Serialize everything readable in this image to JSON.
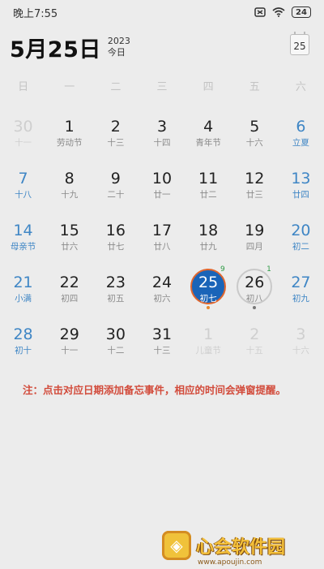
{
  "status": {
    "time": "晚上7:55",
    "battery": "24"
  },
  "header": {
    "date": "5月25日",
    "year": "2023",
    "today_label": "今日",
    "today_button": "25"
  },
  "weekdays": [
    "日",
    "一",
    "二",
    "三",
    "四",
    "五",
    "六"
  ],
  "days": [
    {
      "n": "30",
      "l": "十一",
      "dim": true
    },
    {
      "n": "1",
      "l": "劳动节"
    },
    {
      "n": "2",
      "l": "十三"
    },
    {
      "n": "3",
      "l": "十四"
    },
    {
      "n": "4",
      "l": "青年节"
    },
    {
      "n": "5",
      "l": "十六"
    },
    {
      "n": "6",
      "l": "立夏",
      "weekend": true
    },
    {
      "n": "7",
      "l": "十八",
      "weekend": true
    },
    {
      "n": "8",
      "l": "十九"
    },
    {
      "n": "9",
      "l": "二十"
    },
    {
      "n": "10",
      "l": "廿一"
    },
    {
      "n": "11",
      "l": "廿二"
    },
    {
      "n": "12",
      "l": "廿三"
    },
    {
      "n": "13",
      "l": "廿四",
      "weekend": true
    },
    {
      "n": "14",
      "l": "母亲节",
      "weekend": true
    },
    {
      "n": "15",
      "l": "廿六"
    },
    {
      "n": "16",
      "l": "廿七"
    },
    {
      "n": "17",
      "l": "廿八"
    },
    {
      "n": "18",
      "l": "廿九"
    },
    {
      "n": "19",
      "l": "四月"
    },
    {
      "n": "20",
      "l": "初二",
      "weekend": true
    },
    {
      "n": "21",
      "l": "小满",
      "weekend": true
    },
    {
      "n": "22",
      "l": "初四"
    },
    {
      "n": "23",
      "l": "初五"
    },
    {
      "n": "24",
      "l": "初六"
    },
    {
      "n": "25",
      "l": "初七",
      "today": true,
      "badge": "9"
    },
    {
      "n": "26",
      "l": "初八",
      "ring": true,
      "badge": "1"
    },
    {
      "n": "27",
      "l": "初九",
      "weekend": true
    },
    {
      "n": "28",
      "l": "初十",
      "weekend": true
    },
    {
      "n": "29",
      "l": "十一"
    },
    {
      "n": "30",
      "l": "十二"
    },
    {
      "n": "31",
      "l": "十三"
    },
    {
      "n": "1",
      "l": "儿童节",
      "dim": true
    },
    {
      "n": "2",
      "l": "十五",
      "dim": true
    },
    {
      "n": "3",
      "l": "十六",
      "dim": true
    }
  ],
  "note": "注：点击对应日期添加备忘事件，相应的时间会弹窗提醒。",
  "watermark": {
    "text": "心会软件园",
    "url": "www.apoujin.com"
  },
  "colors": {
    "accent": "#1a64b8",
    "weekend": "#3f86c5",
    "note": "#d24b3b"
  }
}
